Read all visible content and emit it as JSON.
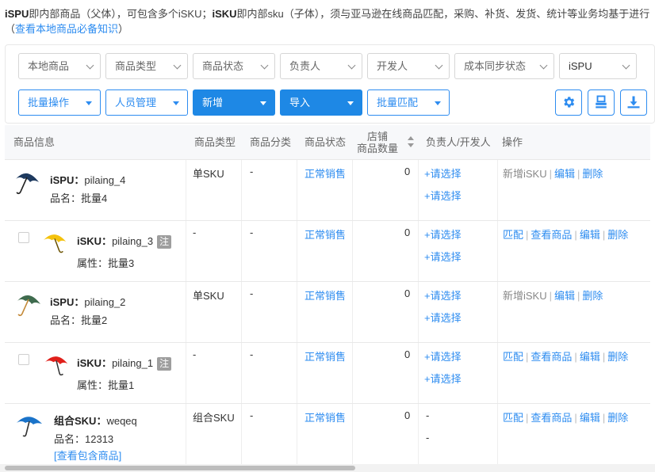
{
  "intro": {
    "ispu_term": "iSPU",
    "ispu_desc": "即内部商品（父体），可包含多个iSKU；",
    "isku_term": "iSKU",
    "isku_desc": "即内部sku（子体），须与亚马逊在线商品匹配，采购、补货、发货、统计等业务均基于进行（",
    "link": "查看本地商品必备知识",
    "tail": "）"
  },
  "filters": {
    "local_goods": "本地商品",
    "goods_type": "商品类型",
    "goods_status": "商品状态",
    "owner": "负责人",
    "developer": "开发人",
    "cost_sync": "成本同步状态",
    "level": "iSPU"
  },
  "toolbar": {
    "batch_ops": "批量操作",
    "staff": "人员管理",
    "add": "新增",
    "import": "导入",
    "batch_match": "批量匹配"
  },
  "table": {
    "headers": {
      "info": "商品信息",
      "type": "商品类型",
      "category": "商品分类",
      "status": "商品状态",
      "store_count_l1": "店铺",
      "store_count_l2": "商品数量",
      "owner": "负责人/开发人",
      "actions": "操作"
    },
    "rows": [
      {
        "kind": "iSPU",
        "kind_label": "iSPU：",
        "code": "pilaing_4",
        "sub_label": "品名：",
        "sub_value": "批量4",
        "type": "单SKU",
        "category": "-",
        "status": "正常销售",
        "count": "0",
        "owner": "+请选择",
        "developer": "+请选择",
        "ops": [
          "新增iSKU",
          "编辑",
          "删除"
        ],
        "color": "#1e3a5f"
      },
      {
        "kind": "iSKU",
        "kind_label": "iSKU：",
        "code": "pilaing_3",
        "tag": "注",
        "sub_label": "属性：",
        "sub_value": "批量3",
        "type": "-",
        "category": "-",
        "status": "正常销售",
        "count": "0",
        "owner": "+请选择",
        "developer": "+请选择",
        "ops": [
          "匹配",
          "查看商品",
          "编辑",
          "删除"
        ],
        "color": "#f4c20d"
      },
      {
        "kind": "iSPU",
        "kind_label": "iSPU：",
        "code": "pilaing_2",
        "sub_label": "品名：",
        "sub_value": "批量2",
        "type": "单SKU",
        "category": "-",
        "status": "正常销售",
        "count": "0",
        "owner": "+请选择",
        "developer": "+请选择",
        "ops": [
          "新增iSKU",
          "编辑",
          "删除"
        ],
        "color": "#3f6b4e"
      },
      {
        "kind": "iSKU",
        "kind_label": "iSKU：",
        "code": "pilaing_1",
        "tag": "注",
        "sub_label": "属性：",
        "sub_value": "批量1",
        "type": "-",
        "category": "-",
        "status": "正常销售",
        "count": "0",
        "owner": "+请选择",
        "developer": "+请选择",
        "ops": [
          "匹配",
          "查看商品",
          "编辑",
          "删除"
        ],
        "color": "#e0201b"
      },
      {
        "kind": "combo",
        "kind_label": "组合SKU：",
        "code": "weqeq",
        "sub_label": "品名：",
        "sub_value": "12313",
        "extra_link": "[查看包含商品]",
        "type": "组合SKU",
        "category": "-",
        "status": "正常销售",
        "count": "0",
        "owner": "-",
        "developer": "-",
        "ops": [
          "匹配",
          "查看商品",
          "编辑",
          "删除"
        ],
        "color": "#1a73c9"
      }
    ]
  },
  "icons": [
    "gear-icon",
    "print-icon",
    "download-icon",
    "sort-icon",
    "umbrella-icon"
  ],
  "colors": {
    "accent": "#2d8cf0",
    "primary_button": "#1e88e5"
  }
}
